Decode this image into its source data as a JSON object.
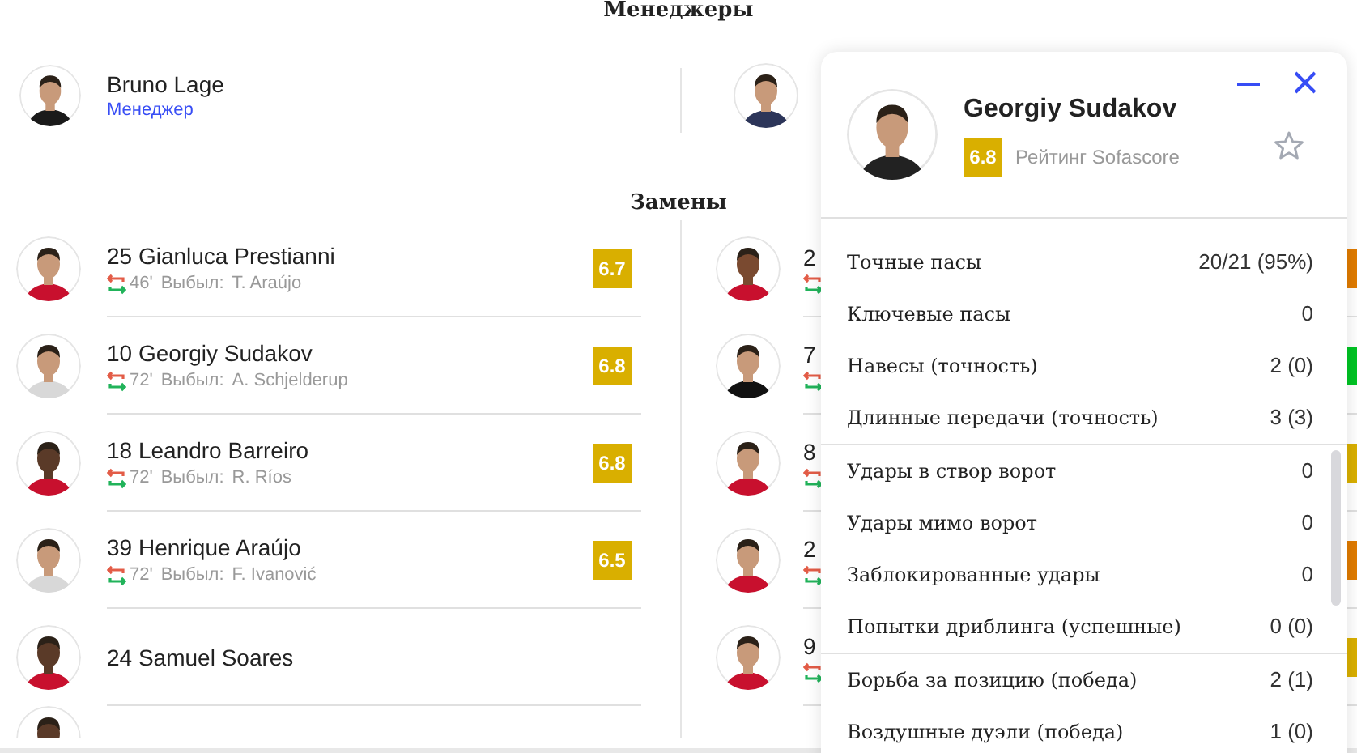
{
  "managers": {
    "title": "Менеджеры",
    "home": {
      "name": "Bruno Lage",
      "role": "Менеджер"
    }
  },
  "substitutes": {
    "title": "Замены",
    "home": [
      {
        "player": "25 Gianluca Prestianni",
        "minute": "46'",
        "out_label": "Выбыл:",
        "out_player": "T. Araújo",
        "rating": "6.7",
        "color": "#d9af00"
      },
      {
        "player": "10 Georgiy Sudakov",
        "minute": "72'",
        "out_label": "Выбыл:",
        "out_player": "A. Schjelderup",
        "rating": "6.8",
        "color": "#d9af00"
      },
      {
        "player": "18 Leandro Barreiro",
        "minute": "72'",
        "out_label": "Выбыл:",
        "out_player": "R. Ríos",
        "rating": "6.8",
        "color": "#d9af00"
      },
      {
        "player": "39 Henrique Araújo",
        "minute": "72'",
        "out_label": "Выбыл:",
        "out_player": "F. Ivanović",
        "rating": "6.5",
        "color": "#d9af00"
      },
      {
        "player": "24 Samuel Soares"
      }
    ],
    "away": [
      {
        "player": "2",
        "color": "#e07b00"
      },
      {
        "player": "7",
        "color": "#00c424"
      },
      {
        "player": "8",
        "color": "#d9af00"
      },
      {
        "player": "2",
        "color": "#e07b00"
      },
      {
        "player": "9",
        "color": "#d9af00"
      }
    ]
  },
  "popup": {
    "name": "Georgiy Sudakov",
    "rating": "6.8",
    "rating_label": "Рейтинг Sofascore",
    "favorite": false,
    "stat_groups": [
      [
        {
          "label": "Точные пасы",
          "value": "20/21 (95%)"
        },
        {
          "label": "Ключевые пасы",
          "value": "0"
        },
        {
          "label": "Навесы (точность)",
          "value": "2 (0)"
        },
        {
          "label": "Длинные передачи (точность)",
          "value": "3 (3)"
        }
      ],
      [
        {
          "label": "Удары в створ ворот",
          "value": "0"
        },
        {
          "label": "Удары мимо ворот",
          "value": "0"
        },
        {
          "label": "Заблокированные удары",
          "value": "0"
        },
        {
          "label": "Попытки дриблинга (успешные)",
          "value": "0 (0)"
        }
      ],
      [
        {
          "label": "Борьба за позицию (победа)",
          "value": "2 (1)"
        },
        {
          "label": "Воздушные дуэли (победа)",
          "value": "1 (0)"
        }
      ]
    ]
  }
}
